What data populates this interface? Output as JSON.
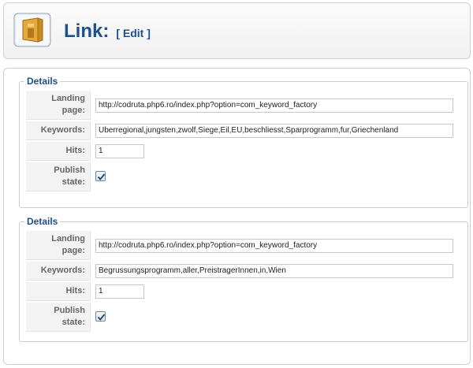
{
  "header": {
    "title": "Link:",
    "edit_tag": "[ Edit ]"
  },
  "icons": {
    "header": "folder-link-icon"
  },
  "colors": {
    "title": "#1e4f8f",
    "legend": "#1a4f8e"
  },
  "sections": [
    {
      "legend": "Details",
      "fields": {
        "landing_label": "Landing page:",
        "landing_value": "http://codruta.php6.ro/index.php?option=com_keyword_factory",
        "keywords_label": "Keywords:",
        "keywords_value": "Uberregional,jungsten,zwolf,Siege,Eil,EU,beschliesst,Sparprogramm,fur,Griechenland",
        "hits_label": "Hits:",
        "hits_value": "1",
        "publish_label": "Publish state:",
        "publish_checked": true
      }
    },
    {
      "legend": "Details",
      "fields": {
        "landing_label": "Landing page:",
        "landing_value": "http://codruta.php6.ro/index.php?option=com_keyword_factory",
        "keywords_label": "Keywords:",
        "keywords_value": "Begrussungsprogramm,aller,PreistragerInnen,in,Wien",
        "hits_label": "Hits:",
        "hits_value": "1",
        "publish_label": "Publish state:",
        "publish_checked": true
      }
    }
  ]
}
